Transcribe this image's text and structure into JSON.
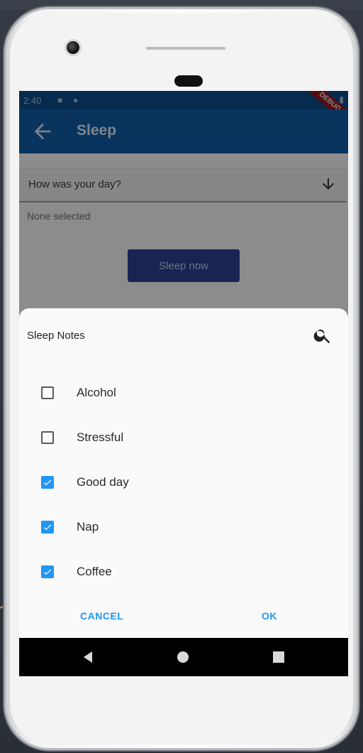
{
  "status_bar": {
    "time": "2:40",
    "debug_banner": "DEBUG"
  },
  "app_bar": {
    "title": "Sleep",
    "back_icon": "arrow-back-icon"
  },
  "form": {
    "dropdown_label": "How was your day?",
    "dropdown_icon": "arrow-down-icon",
    "selected_text": "None selected",
    "sleep_button": "Sleep now"
  },
  "dialog": {
    "title": "Sleep Notes",
    "search_icon": "search-icon",
    "options": [
      {
        "label": "Alcohol",
        "checked": false
      },
      {
        "label": "Stressful",
        "checked": false
      },
      {
        "label": "Good day",
        "checked": true
      },
      {
        "label": "Nap",
        "checked": true
      },
      {
        "label": "Coffee",
        "checked": true
      }
    ],
    "cancel_label": "CANCEL",
    "ok_label": "OK"
  },
  "colors": {
    "app_bar": "#0f5aa3",
    "status_bar": "#0d4a87",
    "accent": "#2196f3",
    "button": "#2d3f8f"
  }
}
